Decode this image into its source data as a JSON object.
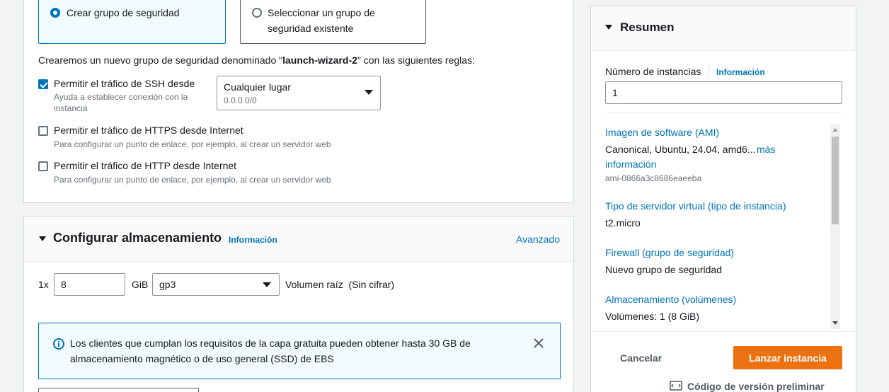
{
  "network": {
    "radio_create": "Crear grupo de seguridad",
    "radio_select_line1": "Seleccionar un grupo de",
    "radio_select_line2": "seguridad existente",
    "rules_prefix": "Crearemos un nuevo grupo de seguridad denominado \"",
    "rules_name": "launch-wizard-2",
    "rules_suffix": "\" con las siguientes reglas:",
    "ssh_label": "Permitir el tráfico de SSH desde",
    "ssh_help_line1": "Ayuda a establecer conexión con la",
    "ssh_help_line2": "instancia",
    "ssh_select_value": "Cualquier lugar",
    "ssh_select_sub": "0.0.0.0/0",
    "https_label": "Permitir el tráfico de HTTPS desde Internet",
    "https_help": "Para configurar un punto de enlace, por ejemplo, al crear un servidor web",
    "http_label": "Permitir el tráfico de HTTP desde Internet",
    "http_help": "Para configurar un punto de enlace, por ejemplo, al crear un servidor web"
  },
  "storage": {
    "title": "Configurar almacenamiento",
    "info": "Información",
    "advanced": "Avanzado",
    "count": "1x",
    "size_value": "8",
    "unit": "GiB",
    "volume_type": "gp3",
    "volume_desc": "Volumen raíz  (Sin cifrar)",
    "alert_line1": "Los clientes que cumplan los requisitos de la capa gratuita pueden obtener hasta 30 GB de",
    "alert_line2": "almacenamiento magnético o de uso general (SSD) de EBS"
  },
  "summary": {
    "title": "Resumen",
    "instances_label": "Número de instancias",
    "instances_info": "Información",
    "instances_value": "1",
    "ami_title": "Imagen de software (AMI)",
    "ami_value": "Canonical, Ubuntu, 24.04, amd6...",
    "ami_more_1": "más",
    "ami_more_2": "información",
    "ami_id": "ami-0866a3c8686eaeeba",
    "type_title": "Tipo de servidor virtual (tipo de instancia)",
    "type_value": "t2.micro",
    "firewall_title": "Firewall (grupo de seguridad)",
    "firewall_value": "Nuevo grupo de seguridad",
    "storage_title": "Almacenamiento (volúmenes)",
    "storage_value": "Volúmenes: 1 (8 GiB)",
    "cancel": "Cancelar",
    "launch": "Lanzar instancia",
    "preview": "Código de versión preliminar"
  }
}
